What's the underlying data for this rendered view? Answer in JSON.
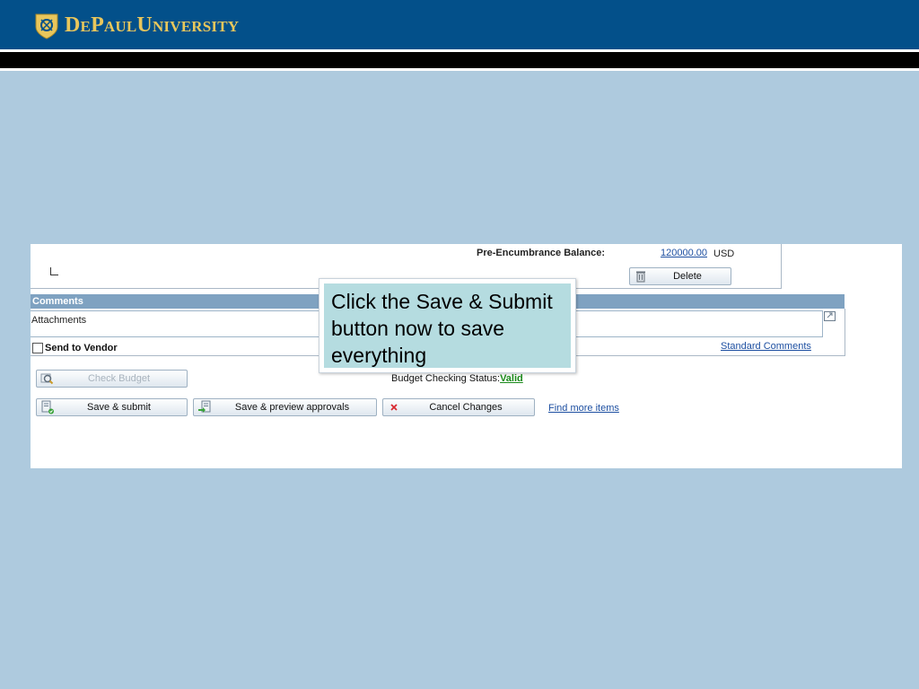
{
  "header": {
    "brand": "DePaulUniversity",
    "bg_color": "#03508a",
    "brand_color": "#e9c65c"
  },
  "balance": {
    "label": "Pre-Encumbrance Balance:",
    "value": "120000.00",
    "unit": "USD"
  },
  "buttons": {
    "delete": "Delete",
    "check_budget": "Check Budget",
    "save_submit": "Save & submit",
    "save_preview": "Save & preview approvals",
    "cancel": "Cancel Changes"
  },
  "comments": {
    "title": "Comments",
    "attachments_label": "Attachments",
    "send_to_vendor": "Send to Vendor",
    "standard_comments": "Standard Comments"
  },
  "budget": {
    "label": "Budget Checking Status:",
    "status": "Valid"
  },
  "links": {
    "find_more": "Find more items"
  },
  "callout": {
    "text": "Click the Save & Submit button now to save everything"
  },
  "icons": {
    "logo": "depaul-seal-icon",
    "delete": "trash-icon",
    "check_budget": "magnifier-icon",
    "save_submit": "document-check-icon",
    "save_preview": "document-arrow-icon",
    "cancel": "x-icon",
    "expand": "expand-icon"
  }
}
